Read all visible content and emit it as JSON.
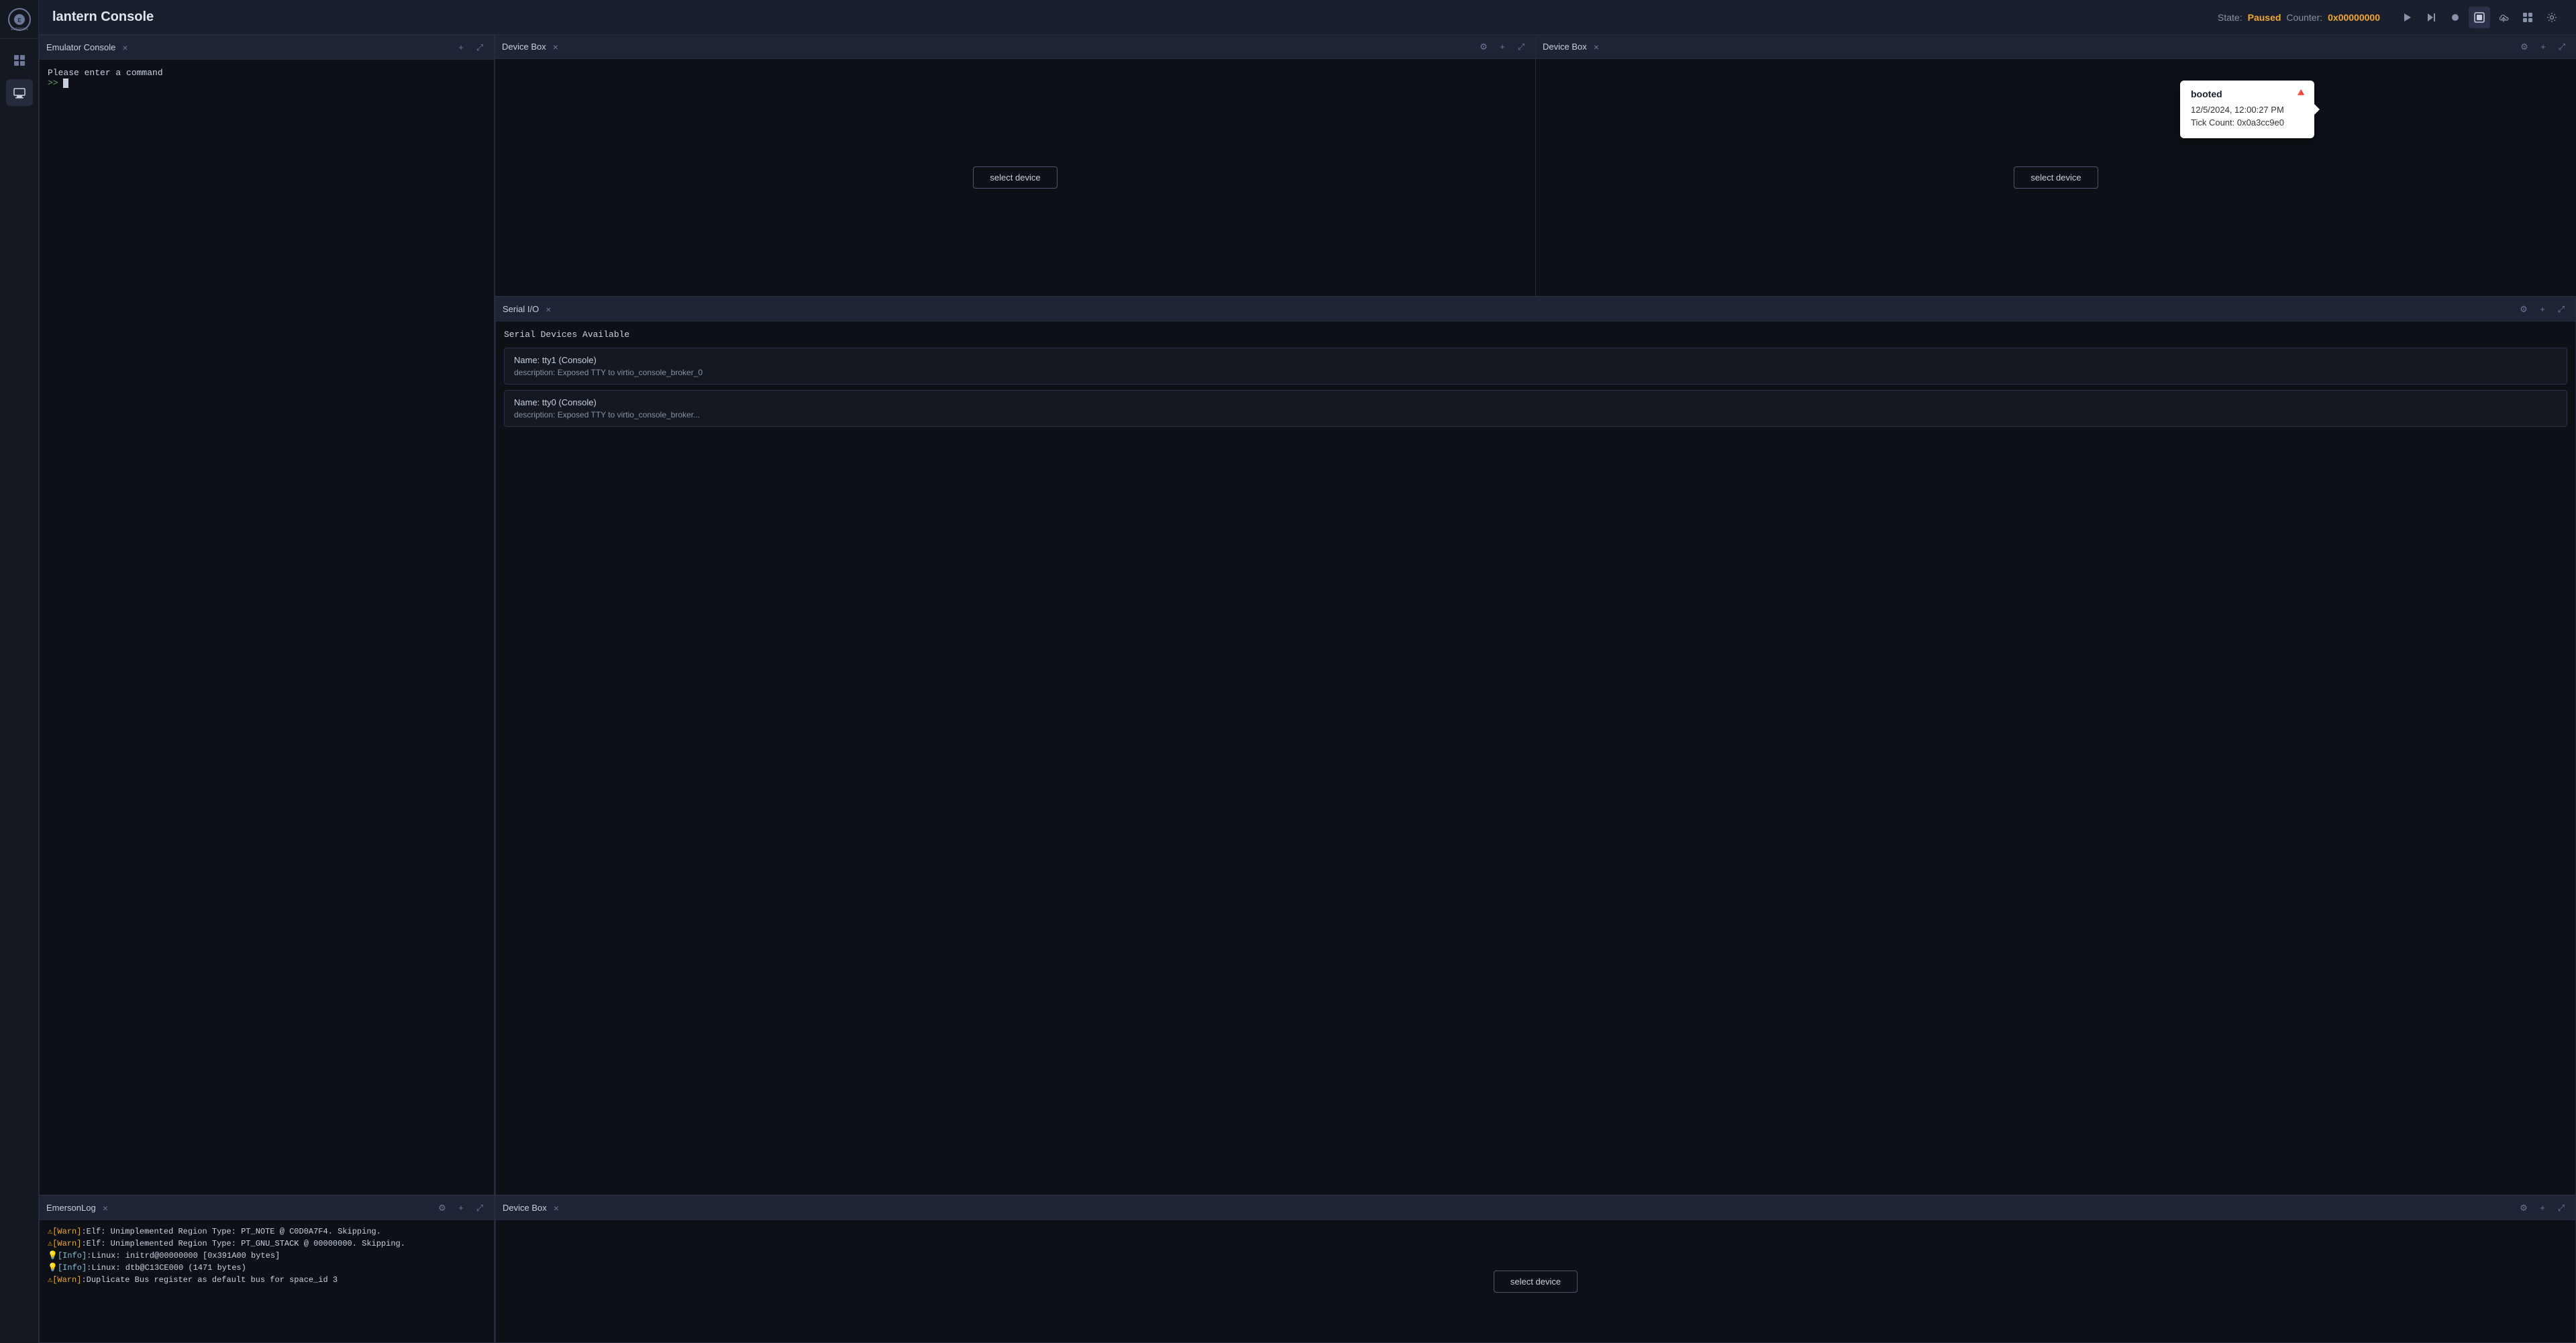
{
  "app": {
    "logo_alt": "Emerson Logo",
    "title": "lantern Console"
  },
  "sidebar": {
    "items": [
      {
        "label": "Panel Layout",
        "icon": "layout-icon",
        "active": false
      },
      {
        "label": "Devices",
        "icon": "devices-icon",
        "active": true
      }
    ]
  },
  "header": {
    "title": "lantern Console",
    "state_label": "State:",
    "state_value": "Paused",
    "counter_label": "Counter:",
    "counter_value": "0x00000000",
    "controls": {
      "play_label": "▶",
      "step_label": "⏭",
      "record_label": "⏺",
      "snapshot_label": "📷",
      "cloud_label": "☁",
      "layout_label": "⊞",
      "settings_label": "⚙"
    }
  },
  "panels": {
    "emulator_console": {
      "title": "Emulator Console",
      "prompt_text": "Please enter a command",
      "prompt_symbol": ">>",
      "icons": {
        "add": "+",
        "expand": "⤢"
      }
    },
    "emerson_log": {
      "title": "EmersonLog",
      "icons": {
        "settings": "⚙",
        "add": "+",
        "expand": "⤢"
      },
      "log_entries": [
        {
          "type": "warn",
          "text": "[Warn]:Elf: Unimplemented Region Type: PT_NOTE @ C0D0A7F4. Skipping."
        },
        {
          "type": "warn",
          "text": "[Warn]:Elf: Unimplemented Region Type: PT_GNU_STACK @ 00000000. Skipping."
        },
        {
          "type": "info",
          "text": "[Info]:Linux: initrd@00000000 [0x391A00 bytes]"
        },
        {
          "type": "info",
          "text": "[Info]:Linux: dtb@C13CE000 (1471 bytes)"
        },
        {
          "type": "warn",
          "text": "[Warn]:Duplicate Bus register as default bus for space_id 3"
        }
      ]
    },
    "device_box_1": {
      "title": "Device Box",
      "select_btn": "select device",
      "icons": {
        "settings": "⚙",
        "add": "+",
        "expand": "⤢"
      }
    },
    "device_box_2": {
      "title": "Device Box",
      "select_btn": "select device",
      "icons": {
        "settings": "⚙",
        "add": "+",
        "expand": "⤢"
      }
    },
    "serial_io": {
      "title": "Serial I/O",
      "section_title": "Serial Devices Available",
      "icons": {
        "settings": "⚙",
        "add": "+",
        "expand": "⤢"
      },
      "devices": [
        {
          "name": "Name: tty1 (Console)",
          "description": "description: Exposed TTY to virtio_console_broker_0"
        },
        {
          "name": "Name: tty0 (Console)",
          "description": "description: Exposed TTY to virtio_console_broker..."
        }
      ]
    },
    "device_box_3": {
      "title": "Device Box",
      "select_btn": "select device",
      "icons": {
        "settings": "⚙",
        "add": "+",
        "expand": "⤢"
      }
    }
  },
  "tooltip": {
    "title": "booted",
    "date": "12/5/2024, 12:00:27 PM",
    "tick_count_label": "Tick Count:",
    "tick_count_value": "0x0a3cc9e0",
    "erase_icon": "🔺"
  }
}
